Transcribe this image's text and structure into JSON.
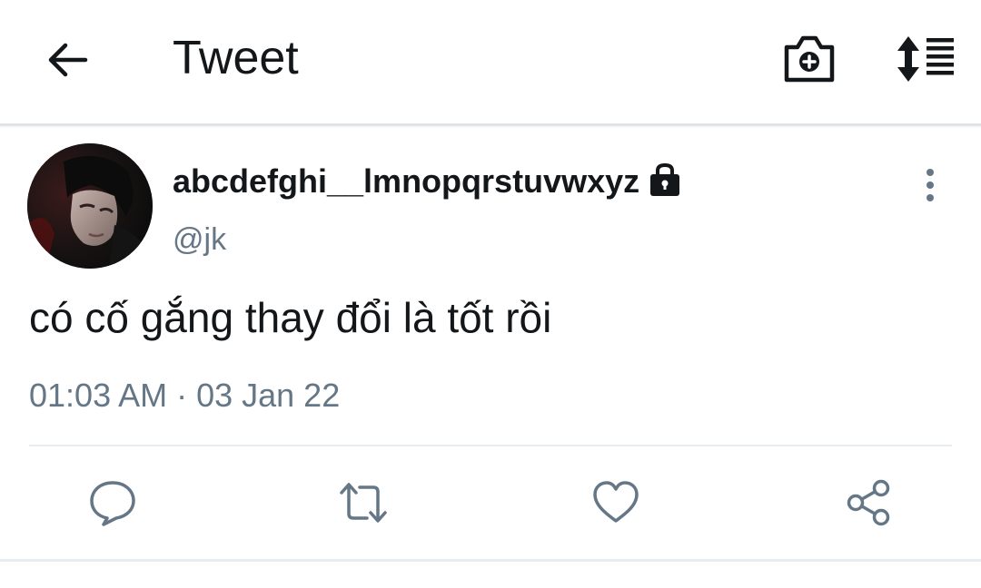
{
  "header": {
    "title": "Tweet",
    "back_icon": "arrow-left-icon",
    "camera_icon": "camera-plus-icon",
    "sort_icon": "sort-list-icon"
  },
  "tweet": {
    "author_name": "abcdefghi__lmnopqrstuvwxyz",
    "handle": "@jk",
    "protected_icon": "lock-icon",
    "text": "có cố gắng thay đổi là tốt rồi",
    "timestamp": "01:03 AM · 03 Jan 22",
    "more_icon": "more-vertical-icon"
  },
  "actions": {
    "reply_icon": "reply-icon",
    "retweet_icon": "retweet-icon",
    "like_icon": "heart-icon",
    "share_icon": "share-icon"
  },
  "colors": {
    "text_primary": "#14171a",
    "text_secondary": "#657786",
    "icon_secondary": "#657786",
    "divider": "#e6ecf0"
  }
}
